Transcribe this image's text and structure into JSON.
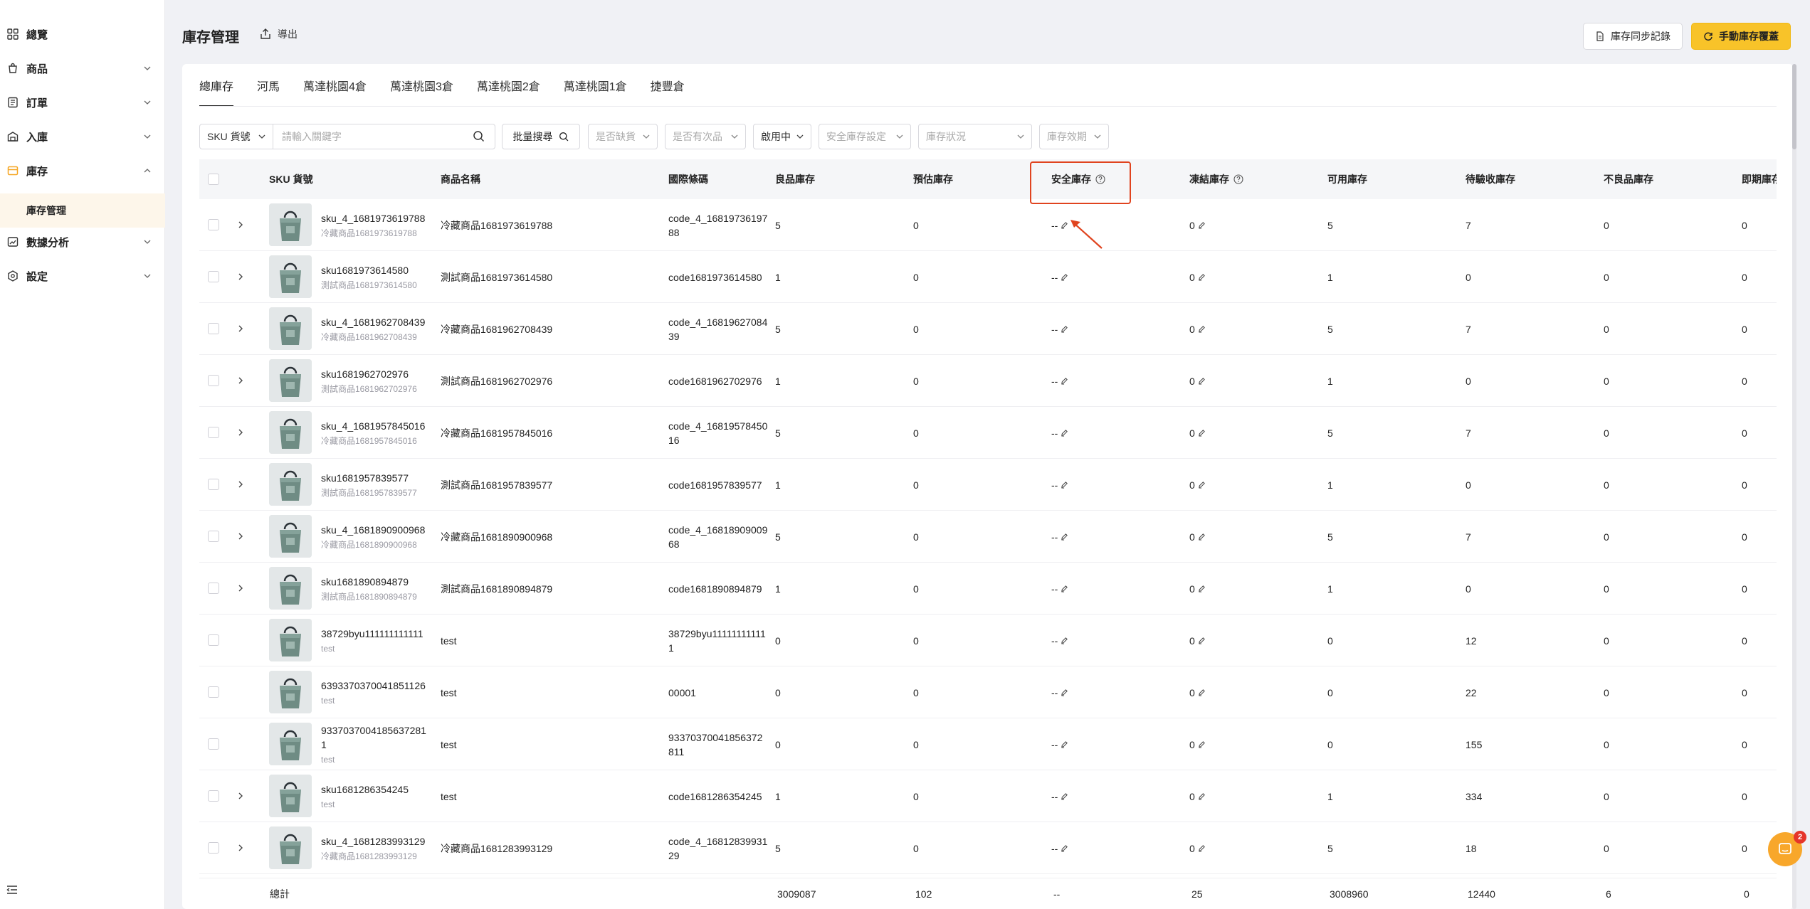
{
  "sidebar": {
    "items": [
      {
        "label": "總覽",
        "icon": "grid-icon"
      },
      {
        "label": "商品",
        "icon": "product-bag-icon"
      },
      {
        "label": "訂單",
        "icon": "order-list-icon"
      },
      {
        "label": "入庫",
        "icon": "warehouse-in-icon"
      },
      {
        "label": "庫存",
        "icon": "inventory-box-icon"
      },
      {
        "label": "數據分析",
        "icon": "analytics-chart-icon"
      },
      {
        "label": "設定",
        "icon": "settings-hexagon-icon"
      }
    ],
    "sub_item": "庫存管理",
    "accent": "#f5a623"
  },
  "header": {
    "title": "庫存管理",
    "export_label": "導出",
    "sync_label": "庫存同步記錄",
    "override_label": "手動庫存覆蓋"
  },
  "tabs": [
    "總庫存",
    "河馬",
    "萬達桃園4倉",
    "萬達桃園3倉",
    "萬達桃園2倉",
    "萬達桃園1倉",
    "捷豐倉"
  ],
  "filters": {
    "sku_select": "SKU 貨號",
    "search_placeholder": "請輸入關鍵字",
    "batch_search": "批量搜尋",
    "shortage": "是否缺貨",
    "defective": "是否有次品",
    "status": "啟用中",
    "safety": "安全庫存設定",
    "stock_status": "庫存狀況",
    "expiry": "庫存效期"
  },
  "columns": [
    "SKU 貨號",
    "商品名稱",
    "國際條碼",
    "良品庫存",
    "預估庫存",
    "安全庫存",
    "凍結庫存",
    "可用庫存",
    "待驗收庫存",
    "不良品庫存",
    "即期庫存"
  ],
  "rows": [
    {
      "sku": "sku_4_1681973619788",
      "sub": "冷藏商品1681973619788",
      "name": "冷藏商品1681973619788",
      "code": "code_4_1681973619788",
      "good": "5",
      "est": "0",
      "safety": "--",
      "frozen": "0",
      "avail": "5",
      "pending": "7",
      "bad": "0",
      "near": "0",
      "expand": true
    },
    {
      "sku": "sku1681973614580",
      "sub": "測試商品1681973614580",
      "name": "測試商品1681973614580",
      "code": "code1681973614580",
      "good": "1",
      "est": "0",
      "safety": "--",
      "frozen": "0",
      "avail": "1",
      "pending": "0",
      "bad": "0",
      "near": "0",
      "expand": true
    },
    {
      "sku": "sku_4_1681962708439",
      "sub": "冷藏商品1681962708439",
      "name": "冷藏商品1681962708439",
      "code": "code_4_1681962708439",
      "good": "5",
      "est": "0",
      "safety": "--",
      "frozen": "0",
      "avail": "5",
      "pending": "7",
      "bad": "0",
      "near": "0",
      "expand": true
    },
    {
      "sku": "sku1681962702976",
      "sub": "測試商品1681962702976",
      "name": "測試商品1681962702976",
      "code": "code1681962702976",
      "good": "1",
      "est": "0",
      "safety": "--",
      "frozen": "0",
      "avail": "1",
      "pending": "0",
      "bad": "0",
      "near": "0",
      "expand": true
    },
    {
      "sku": "sku_4_1681957845016",
      "sub": "冷藏商品1681957845016",
      "name": "冷藏商品1681957845016",
      "code": "code_4_1681957845016",
      "good": "5",
      "est": "0",
      "safety": "--",
      "frozen": "0",
      "avail": "5",
      "pending": "7",
      "bad": "0",
      "near": "0",
      "expand": true
    },
    {
      "sku": "sku1681957839577",
      "sub": "測試商品1681957839577",
      "name": "測試商品1681957839577",
      "code": "code1681957839577",
      "good": "1",
      "est": "0",
      "safety": "--",
      "frozen": "0",
      "avail": "1",
      "pending": "0",
      "bad": "0",
      "near": "0",
      "expand": true
    },
    {
      "sku": "sku_4_1681890900968",
      "sub": "冷藏商品1681890900968",
      "name": "冷藏商品1681890900968",
      "code": "code_4_1681890900968",
      "good": "5",
      "est": "0",
      "safety": "--",
      "frozen": "0",
      "avail": "5",
      "pending": "7",
      "bad": "0",
      "near": "0",
      "expand": true
    },
    {
      "sku": "sku1681890894879",
      "sub": "測試商品1681890894879",
      "name": "測試商品1681890894879",
      "code": "code1681890894879",
      "good": "1",
      "est": "0",
      "safety": "--",
      "frozen": "0",
      "avail": "1",
      "pending": "0",
      "bad": "0",
      "near": "0",
      "expand": true
    },
    {
      "sku": "38729byu111111111111",
      "sub": "test",
      "name": "test",
      "code": "38729byu111111111111",
      "good": "0",
      "est": "0",
      "safety": "--",
      "frozen": "0",
      "avail": "0",
      "pending": "12",
      "bad": "0",
      "near": "0",
      "expand": false
    },
    {
      "sku": "6393370370041851126",
      "sub": "test",
      "name": "test",
      "code": "00001",
      "good": "0",
      "est": "0",
      "safety": "--",
      "frozen": "0",
      "avail": "0",
      "pending": "22",
      "bad": "0",
      "near": "0",
      "expand": false
    },
    {
      "sku": "93370370041856372811",
      "sub": "test",
      "name": "test",
      "code": "93370370041856372811",
      "good": "0",
      "est": "0",
      "safety": "--",
      "frozen": "0",
      "avail": "0",
      "pending": "155",
      "bad": "0",
      "near": "0",
      "expand": false
    },
    {
      "sku": "sku1681286354245",
      "sub": "test",
      "name": "test",
      "code": "code1681286354245",
      "good": "1",
      "est": "0",
      "safety": "--",
      "frozen": "0",
      "avail": "1",
      "pending": "334",
      "bad": "0",
      "near": "0",
      "expand": true
    },
    {
      "sku": "sku_4_1681283993129",
      "sub": "冷藏商品1681283993129",
      "name": "冷藏商品1681283993129",
      "code": "code_4_1681283993129",
      "good": "5",
      "est": "0",
      "safety": "--",
      "frozen": "0",
      "avail": "5",
      "pending": "18",
      "bad": "0",
      "near": "0",
      "expand": true
    }
  ],
  "totals": {
    "label": "總計",
    "good": "3009087",
    "est": "102",
    "safety": "--",
    "frozen": "25",
    "avail": "3008960",
    "pending": "12440",
    "bad": "6",
    "near": "0"
  },
  "chat_badge": "2",
  "colors": {
    "accent": "#f8c329",
    "highlight": "#e0441f",
    "chat": "#f8a72b"
  }
}
